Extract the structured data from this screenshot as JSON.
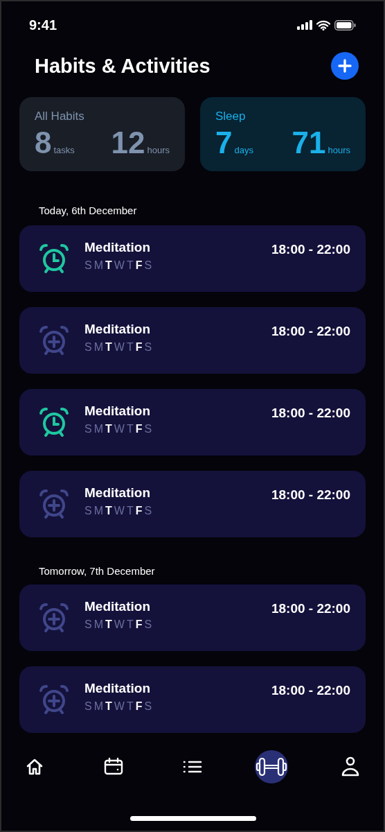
{
  "status_bar": {
    "time": "9:41"
  },
  "header": {
    "title": "Habits & Activities"
  },
  "stats": [
    {
      "title": "All Habits",
      "color": "#7e93ad",
      "values": [
        {
          "number": "8",
          "unit": "tasks"
        },
        {
          "number": "12",
          "unit": "hours"
        }
      ]
    },
    {
      "title": "Sleep",
      "color": "#1ab0ea",
      "values": [
        {
          "number": "7",
          "unit": "days"
        },
        {
          "number": "71",
          "unit": "hours"
        }
      ]
    }
  ],
  "sections": [
    {
      "label": "Today, 6th December",
      "activities": [
        {
          "kind": "alarm",
          "name": "Meditation",
          "time": "18:00 - 22:00",
          "days": [
            {
              "letter": "S",
              "highlighted": false
            },
            {
              "letter": "M",
              "highlighted": false
            },
            {
              "letter": "T",
              "highlighted": true
            },
            {
              "letter": "W",
              "highlighted": false
            },
            {
              "letter": "T",
              "highlighted": false
            },
            {
              "letter": "F",
              "highlighted": true
            },
            {
              "letter": "S",
              "highlighted": false
            }
          ]
        },
        {
          "kind": "add-alarm",
          "name": "Meditation",
          "time": "18:00 - 22:00",
          "days": [
            {
              "letter": "S",
              "highlighted": false
            },
            {
              "letter": "M",
              "highlighted": false
            },
            {
              "letter": "T",
              "highlighted": true
            },
            {
              "letter": "W",
              "highlighted": false
            },
            {
              "letter": "T",
              "highlighted": false
            },
            {
              "letter": "F",
              "highlighted": true
            },
            {
              "letter": "S",
              "highlighted": false
            }
          ]
        },
        {
          "kind": "alarm",
          "name": "Meditation",
          "time": "18:00 - 22:00",
          "days": [
            {
              "letter": "S",
              "highlighted": false
            },
            {
              "letter": "M",
              "highlighted": false
            },
            {
              "letter": "T",
              "highlighted": true
            },
            {
              "letter": "W",
              "highlighted": false
            },
            {
              "letter": "T",
              "highlighted": false
            },
            {
              "letter": "F",
              "highlighted": true
            },
            {
              "letter": "S",
              "highlighted": false
            }
          ]
        },
        {
          "kind": "add-alarm",
          "name": "Meditation",
          "time": "18:00 - 22:00",
          "days": [
            {
              "letter": "S",
              "highlighted": false
            },
            {
              "letter": "M",
              "highlighted": false
            },
            {
              "letter": "T",
              "highlighted": true
            },
            {
              "letter": "W",
              "highlighted": false
            },
            {
              "letter": "T",
              "highlighted": false
            },
            {
              "letter": "F",
              "highlighted": true
            },
            {
              "letter": "S",
              "highlighted": false
            }
          ]
        }
      ]
    },
    {
      "label": "Tomorrow, 7th December",
      "activities": [
        {
          "kind": "add-alarm",
          "name": "Meditation",
          "time": "18:00 - 22:00",
          "days": [
            {
              "letter": "S",
              "highlighted": false
            },
            {
              "letter": "M",
              "highlighted": false
            },
            {
              "letter": "T",
              "highlighted": true
            },
            {
              "letter": "W",
              "highlighted": false
            },
            {
              "letter": "T",
              "highlighted": false
            },
            {
              "letter": "F",
              "highlighted": true
            },
            {
              "letter": "S",
              "highlighted": false
            }
          ]
        },
        {
          "kind": "add-alarm",
          "name": "Meditation",
          "time": "18:00 - 22:00",
          "days": [
            {
              "letter": "S",
              "highlighted": false
            },
            {
              "letter": "M",
              "highlighted": false
            },
            {
              "letter": "T",
              "highlighted": true
            },
            {
              "letter": "W",
              "highlighted": false
            },
            {
              "letter": "T",
              "highlighted": false
            },
            {
              "letter": "F",
              "highlighted": true
            },
            {
              "letter": "S",
              "highlighted": false
            }
          ]
        }
      ]
    }
  ],
  "bottom_nav": [
    {
      "kind": "home",
      "selected": false
    },
    {
      "kind": "calendar",
      "selected": false
    },
    {
      "kind": "list",
      "selected": false
    },
    {
      "kind": "dumbbell",
      "selected": true
    },
    {
      "kind": "profile",
      "selected": false
    }
  ]
}
